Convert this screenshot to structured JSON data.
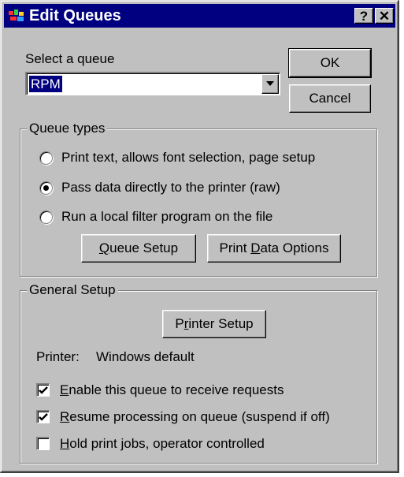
{
  "window": {
    "title": "Edit Queues",
    "help_label": "?",
    "close_label": "✕"
  },
  "queue_select": {
    "label": "Select a queue",
    "value": "RPM"
  },
  "buttons": {
    "ok": "OK",
    "cancel": "Cancel",
    "queue_setup": {
      "pre": "",
      "key": "Q",
      "post": "ueue Setup"
    },
    "print_data_options": {
      "pre": "Print ",
      "key": "D",
      "post": "ata Options"
    },
    "printer_setup": {
      "pre": "P",
      "key": "r",
      "post": "inter Setup"
    }
  },
  "queue_types": {
    "title": "Queue types",
    "options": [
      {
        "label": "Print text, allows font selection, page setup",
        "selected": false
      },
      {
        "label": "Pass data directly to the printer (raw)",
        "selected": true
      },
      {
        "label": "Run a local filter program on the file",
        "selected": false
      }
    ]
  },
  "general_setup": {
    "title": "General Setup",
    "printer_label": "Printer:",
    "printer_value": "Windows default",
    "checkboxes": [
      {
        "key": "E",
        "rest": "nable this queue to receive requests",
        "checked": true
      },
      {
        "key": "R",
        "rest": "esume processing on queue (suspend if off)",
        "checked": true
      },
      {
        "key": "H",
        "rest": "old print jobs, operator controlled",
        "checked": false
      }
    ]
  },
  "colors": {
    "titlebar": "#000080",
    "face": "#c0c0c0",
    "selection": "#000080"
  }
}
